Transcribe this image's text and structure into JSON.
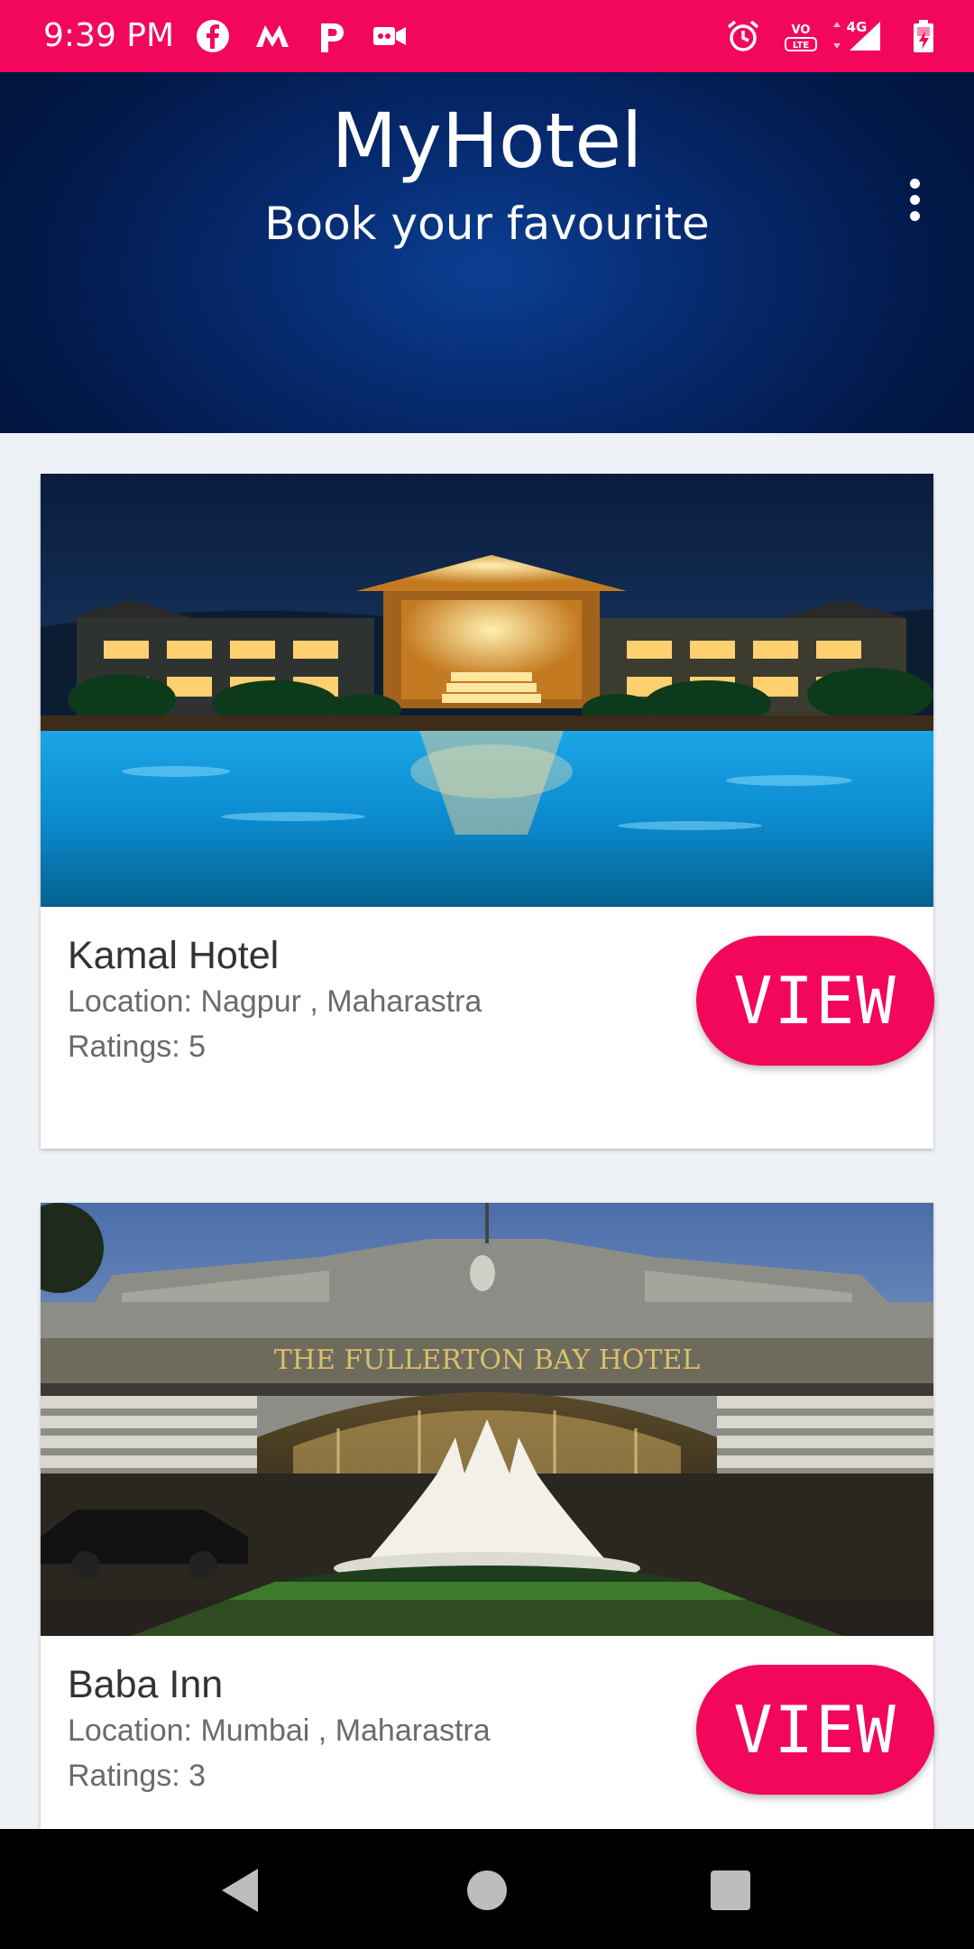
{
  "status_bar": {
    "time": "9:39 PM",
    "network": "4G",
    "left_icons": [
      "facebook-icon",
      "m-app-icon",
      "p-app-icon",
      "video-camera-icon"
    ],
    "right_icons": [
      "alarm-icon",
      "volte-icon",
      "signal-icon",
      "battery-icon"
    ],
    "background": "#f2075a"
  },
  "header": {
    "title": "MyHotel",
    "subtitle": "Book your favourite",
    "menu_icon": "more-vert-icon"
  },
  "hotels": [
    {
      "name": "Kamal Hotel",
      "location": "Location: Nagpur , Maharastra",
      "rating": "Ratings: 5",
      "button_label": "VIEW",
      "image_sign": ""
    },
    {
      "name": "Baba Inn",
      "location": "Location: Mumbai , Maharastra",
      "rating": "Ratings: 3",
      "button_label": "VIEW",
      "image_sign": "THE FULLERTON BAY HOTEL"
    }
  ],
  "nav_bar": {
    "back": "back-triangle-icon",
    "home": "home-circle-icon",
    "recents": "recents-square-icon"
  },
  "colors": {
    "accent": "#f2075a",
    "header_dark": "#01163f",
    "header_light": "#0a3f93",
    "page_background": "#eef1f5"
  }
}
